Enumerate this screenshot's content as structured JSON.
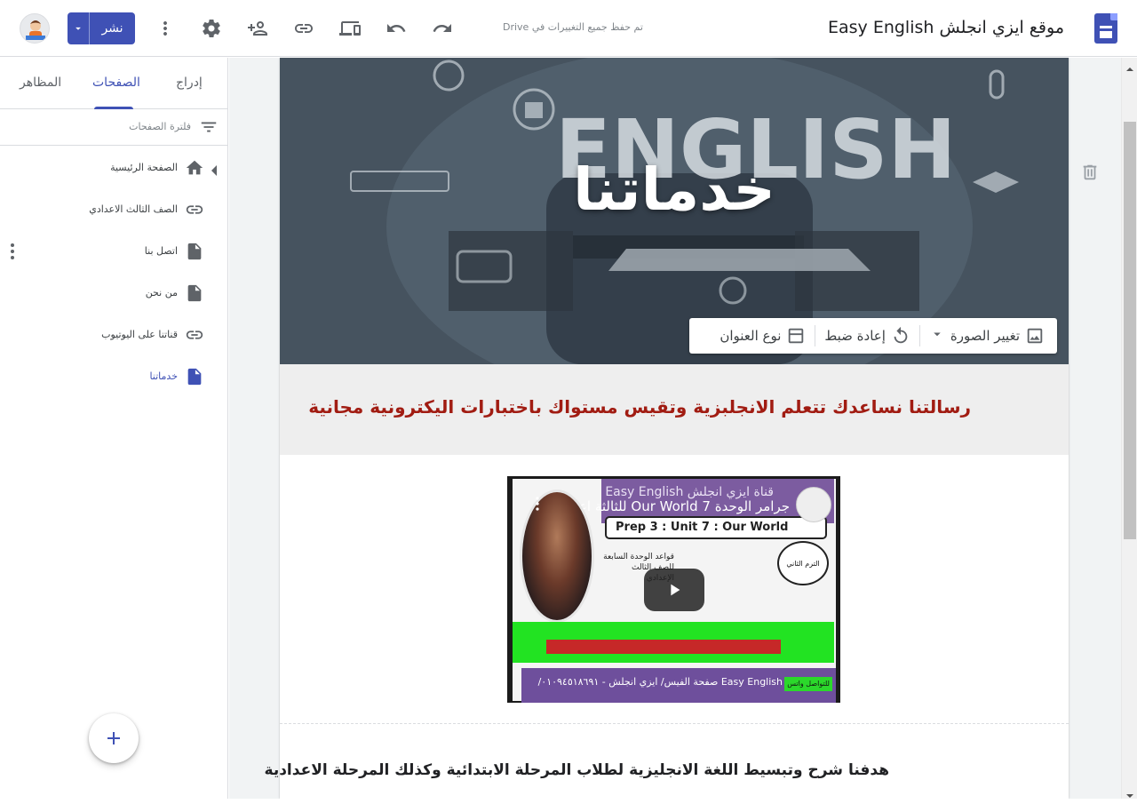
{
  "topbar": {
    "site_title": "موقع ايزي انجلش Easy English",
    "save_status": "تم حفظ جميع التغييرات في Drive",
    "publish_label": "نشر"
  },
  "panel": {
    "tabs": [
      {
        "label": "إدراج"
      },
      {
        "label": "الصفحات"
      },
      {
        "label": "المظاهر"
      }
    ],
    "filter_placeholder": "فلترة الصفحات",
    "pages": [
      {
        "label": "الصفحة الرئيسية",
        "icon": "home-icon"
      },
      {
        "label": "الصف الثالث الاعدادي",
        "icon": "link-icon"
      },
      {
        "label": "اتصل بنا",
        "icon": "document-icon"
      },
      {
        "label": "من نحن",
        "icon": "document-icon"
      },
      {
        "label": "قناتنا على اليوتيوب",
        "icon": "link-icon"
      },
      {
        "label": "خدماتنا",
        "icon": "document-icon"
      }
    ]
  },
  "hero": {
    "title": "خدماتنا",
    "toolbar": {
      "change_image": "تغيير الصورة",
      "reset": "إعادة ضبط",
      "title_type": "نوع العنوان"
    }
  },
  "mission_text": "رسالتنا نساعدك تتعلم الانجلبزية وتقيس مستواك باختبارات اليكترونية  مجانية",
  "video": {
    "channel_title": "قناة ايزي انجلش Easy English",
    "video_title": "جرامر الوحدة Our World 7 للثالثة اعدادي",
    "box_text": "Prep  3 : Unit 7 : Our  World",
    "rules_text": "قواعد الوحدة السابعة للصف الثالث الإعدادي",
    "term_text": "الترم الثاني",
    "footer_text": "Easy English صفحة الفيس/ ايزي انجلش - ٠١٠٩٤٥١٨٦٩١/",
    "contact_text": "للتواصل واتس"
  },
  "goal_text": "هدفنا شرح وتبسيط اللغة الانجليزية لطلاب المرحلة الابتدائية وكذلك المرحلة الاعدادية",
  "colors": {
    "brand": "#3f51b5",
    "mission_text": "#a11c12"
  }
}
